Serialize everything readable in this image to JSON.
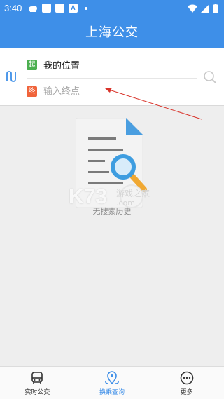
{
  "status_bar": {
    "time": "3:40",
    "a_icon_letter": "A"
  },
  "header": {
    "title": "上海公交"
  },
  "route_search": {
    "start_badge": "起",
    "start_value": "我的位置",
    "end_badge": "终",
    "end_placeholder": "输入终点"
  },
  "empty_state": {
    "message": "无搜索历史"
  },
  "watermark": {
    "logo": "K73",
    "text": "游戏之家",
    "domain": ".com"
  },
  "tabs": [
    {
      "label": "实时公交",
      "icon": "bus-icon",
      "active": false
    },
    {
      "label": "换乘查询",
      "icon": "transfer-icon",
      "active": true
    },
    {
      "label": "更多",
      "icon": "more-icon",
      "active": false
    }
  ],
  "colors": {
    "brand": "#3e8fe8",
    "start_badge": "#4caf50",
    "end_badge": "#f0633a",
    "annotation_arrow": "#d9342b"
  }
}
